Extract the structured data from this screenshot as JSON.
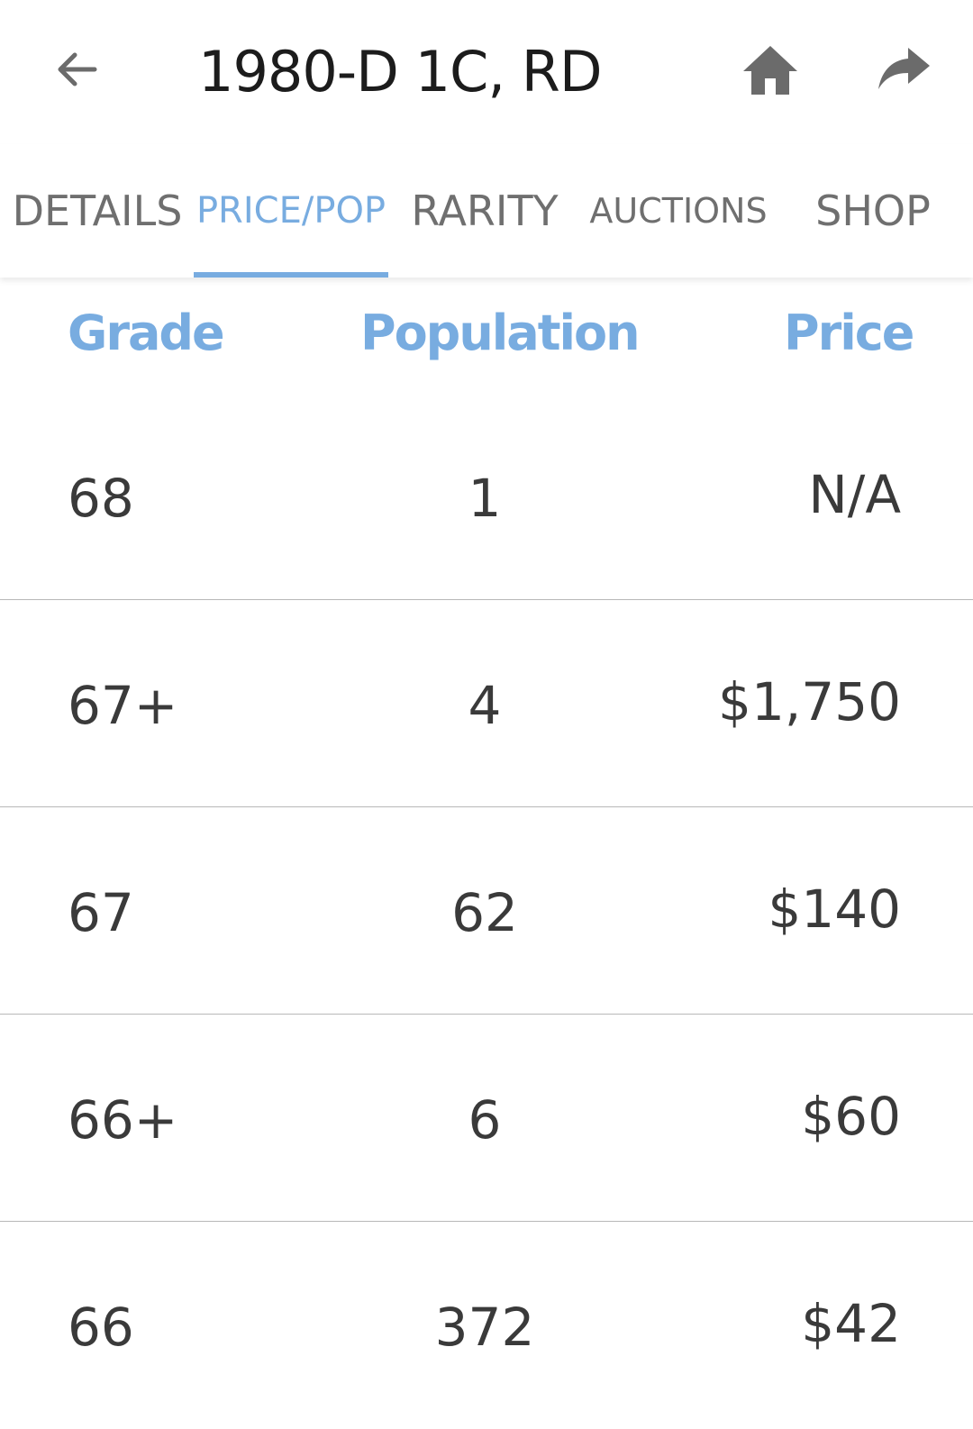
{
  "header": {
    "title": "1980-D 1C, RD",
    "back_icon": "arrow-left-icon",
    "home_icon": "home-icon",
    "share_icon": "share-icon"
  },
  "tabs": [
    {
      "label": "DETAILS",
      "active": false
    },
    {
      "label": "PRICE/POP",
      "active": true
    },
    {
      "label": "RARITY",
      "active": false
    },
    {
      "label": "AUCTIONS",
      "active": false
    },
    {
      "label": "SHOP",
      "active": false
    }
  ],
  "table": {
    "columns": [
      "Grade",
      "Population",
      "Price"
    ],
    "rows": [
      {
        "grade": "68",
        "population": "1",
        "price": "N/A"
      },
      {
        "grade": "67+",
        "population": "4",
        "price": "$1,750"
      },
      {
        "grade": "67",
        "population": "62",
        "price": "$140"
      },
      {
        "grade": "66+",
        "population": "6",
        "price": "$60"
      },
      {
        "grade": "66",
        "population": "372",
        "price": "$42"
      }
    ]
  },
  "colors": {
    "accent": "#78ace0",
    "text": "#3a3a3a",
    "inactive_tab": "#6f6f6f",
    "icon": "#6b6b6b",
    "divider": "#b8b8b8"
  }
}
